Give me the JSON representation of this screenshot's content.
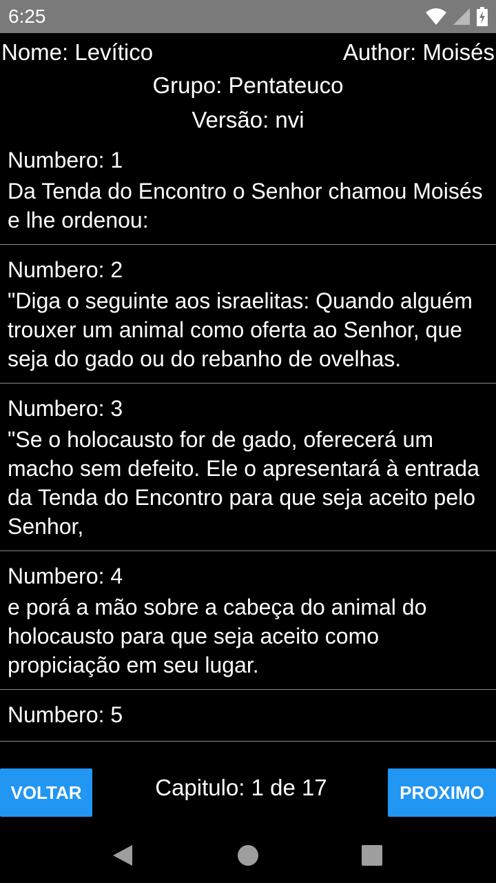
{
  "status_bar": {
    "time": "6:25",
    "icons": [
      "wifi-icon",
      "cell-signal-icon",
      "battery-icon"
    ]
  },
  "header": {
    "name": "Nome: Levítico",
    "author": "Author: Moisés",
    "group": "Grupo: Pentateuco",
    "version": "Versão: nvi"
  },
  "verses": [
    {
      "number": "Numbero: 1",
      "text": "Da Tenda do Encontro o Senhor chamou Moisés e lhe ordenou:"
    },
    {
      "number": "Numbero: 2",
      "text": "\"Diga o seguinte aos israelitas: Quando alguém trouxer um animal como oferta ao Senhor, que seja do gado ou do rebanho de ovelhas."
    },
    {
      "number": "Numbero: 3",
      "text": "\"Se o holocausto for de gado, oferecerá um macho sem defeito. Ele o apresentará à entrada da Tenda do Encontro para que seja aceito pelo Senhor,"
    },
    {
      "number": "Numbero: 4",
      "text": "e porá a mão sobre a cabeça do animal do holocausto para que seja aceito como propiciação em seu lugar."
    },
    {
      "number": "Numbero: 5",
      "text": ""
    }
  ],
  "footer": {
    "back_label": "VOLTAR",
    "chapter": "Capitulo: 1 de 17",
    "next_label": "PROXIMO"
  },
  "colors": {
    "status_bar": "#7a7a7a",
    "background": "#000000",
    "button": "#2196f3",
    "nav_icons": "#9e9e9e"
  },
  "nav_bar": {
    "icons": [
      "back-triangle-icon",
      "home-circle-icon",
      "recents-square-icon"
    ]
  }
}
